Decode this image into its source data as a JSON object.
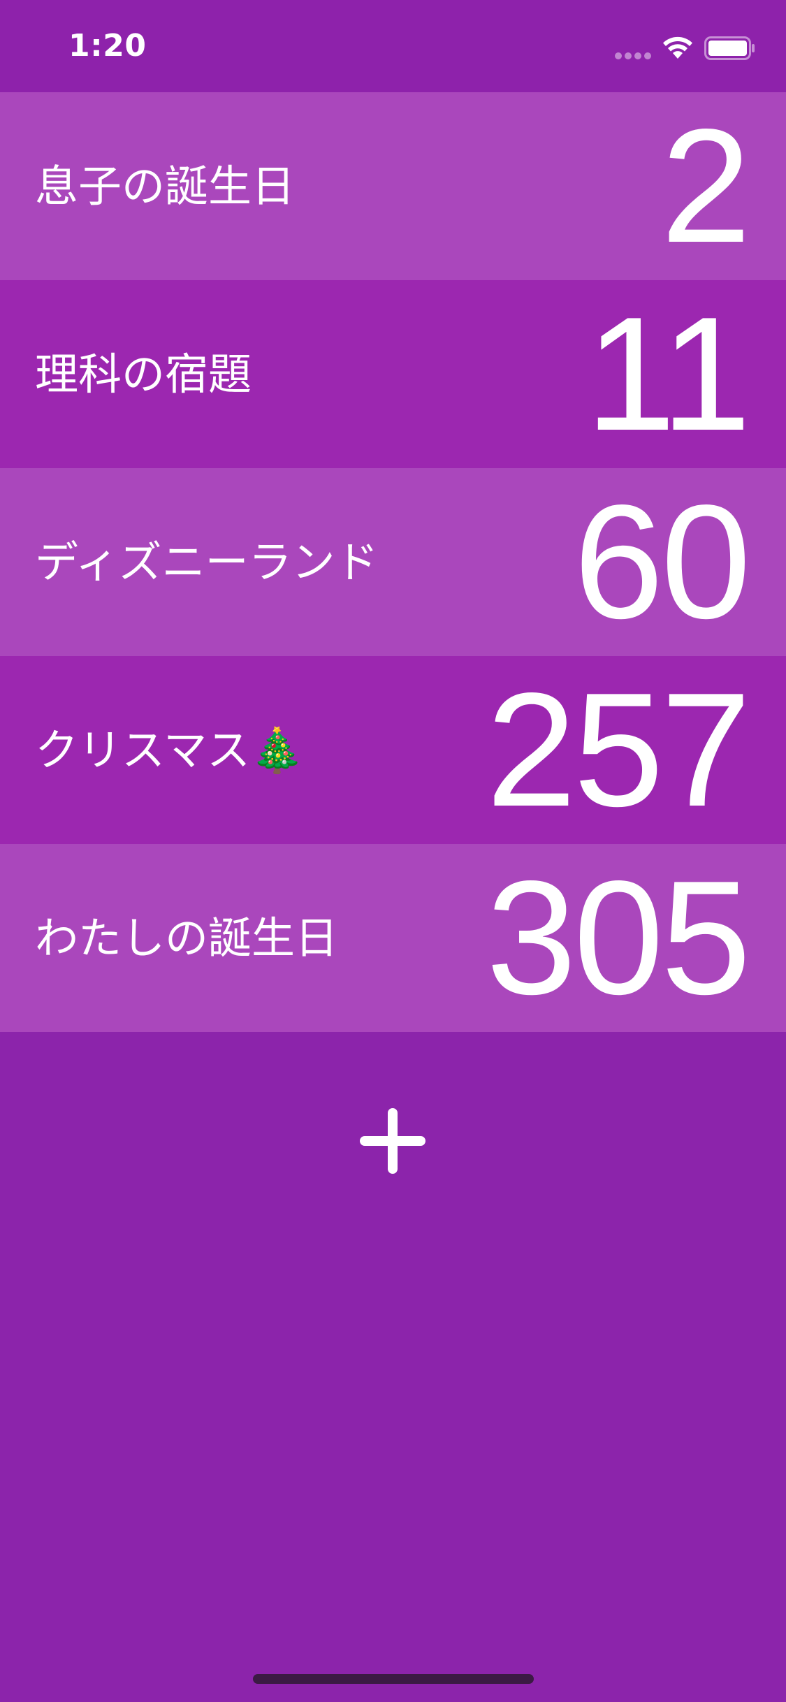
{
  "status_bar": {
    "time": "1:20"
  },
  "events": [
    {
      "label": "息子の誕生日",
      "count": "2"
    },
    {
      "label": "理科の宿題",
      "count": "11"
    },
    {
      "label": "ディズニーランド",
      "count": "60"
    },
    {
      "label": "クリスマス🎄",
      "count": "257"
    },
    {
      "label": "わたしの誕生日",
      "count": "305"
    }
  ],
  "icons": {
    "wifi": "wifi-icon",
    "battery": "battery-icon",
    "add": "plus-icon"
  },
  "colors": {
    "background": "#8c24ab",
    "row_light": "#aa47bc",
    "row_dark": "#9c27b0",
    "text": "#ffffff"
  }
}
